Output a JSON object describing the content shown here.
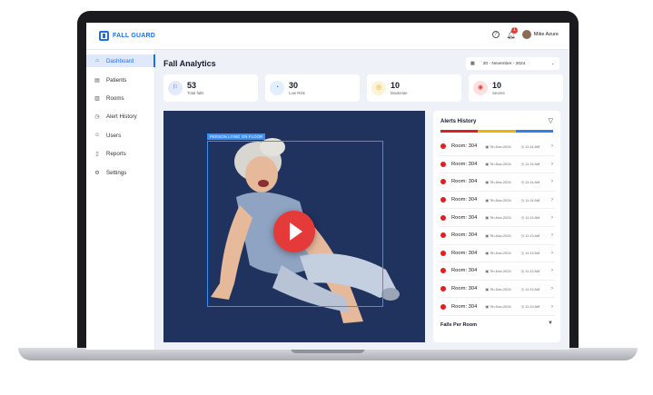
{
  "app": {
    "brand": "FALL GUARD"
  },
  "header": {
    "help_icon": "help-circle-icon",
    "notifications_count": "1",
    "user_name": "Mike Azure"
  },
  "sidebar": {
    "items": [
      {
        "label": "Dashboard",
        "icon": "home-icon",
        "active": true
      },
      {
        "label": "Patients",
        "icon": "patients-icon",
        "active": false
      },
      {
        "label": "Rooms",
        "icon": "rooms-icon",
        "active": false
      },
      {
        "label": "Alert History",
        "icon": "history-icon",
        "active": false
      },
      {
        "label": "Users",
        "icon": "user-icon",
        "active": false
      },
      {
        "label": "Reports",
        "icon": "report-icon",
        "active": false
      },
      {
        "label": "Settings",
        "icon": "settings-icon",
        "active": false
      }
    ]
  },
  "main": {
    "title": "Fall Analytics",
    "date": "20 - November - 2024",
    "stats": [
      {
        "value": "53",
        "label": "Total falls",
        "color": "#4a6fd8",
        "bg": "#e3eafb"
      },
      {
        "value": "30",
        "label": "Low Risk",
        "color": "#2f8de4",
        "bg": "#dff0fc"
      },
      {
        "value": "10",
        "label": "Moderate",
        "color": "#e8a100",
        "bg": "#fdf3d6"
      },
      {
        "value": "10",
        "label": "Severe",
        "color": "#e23b3b",
        "bg": "#fde1e1"
      }
    ],
    "video": {
      "detection_label": "PERSON LYING ON FLOOR"
    }
  },
  "alerts": {
    "title": "Alerts History",
    "severity_colors": [
      "#e02020",
      "#f0b400",
      "#2f80ed"
    ],
    "rows": [
      {
        "room": "Room: 304",
        "date": "7th-Nov-2024",
        "time": "11:14 AM"
      },
      {
        "room": "Room: 304",
        "date": "7th-Nov-2024",
        "time": "11:14 AM"
      },
      {
        "room": "Room: 304",
        "date": "7th-Nov-2024",
        "time": "11:14 AM"
      },
      {
        "room": "Room: 304",
        "date": "7th-Nov-2024",
        "time": "11:14 AM"
      },
      {
        "room": "Room: 304",
        "date": "7th-Nov-2024",
        "time": "11:13 AM"
      },
      {
        "room": "Room: 304",
        "date": "7th-Nov-2024",
        "time": "11:13 AM"
      },
      {
        "room": "Room: 304",
        "date": "7th-Nov-2024",
        "time": "11:13 AM"
      },
      {
        "room": "Room: 304",
        "date": "7th-Nov-2024",
        "time": "11:13 AM"
      },
      {
        "room": "Room: 304",
        "date": "7th-Nov-2024",
        "time": "11:13 AM"
      },
      {
        "room": "Room: 304",
        "date": "7th-Nov-2024",
        "time": "11:13 AM"
      }
    ],
    "falls_per_room_title": "Falls Per Room"
  }
}
